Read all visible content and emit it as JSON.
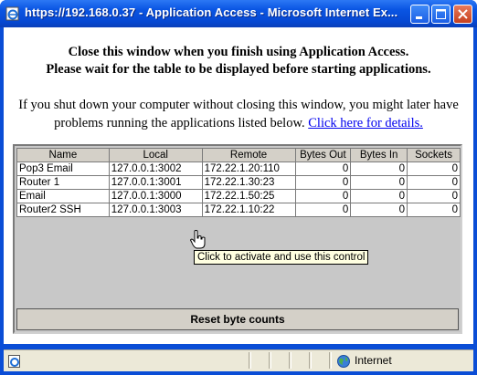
{
  "window": {
    "title": "https://192.168.0.37 - Application Access - Microsoft Internet Ex...",
    "buttons": [
      "minimize-icon",
      "maximize-icon",
      "close-icon"
    ]
  },
  "content": {
    "heading_line1": "Close this window when you finish using Application Access.",
    "heading_line2": "Please wait for the table to be displayed before starting applications.",
    "para_text": "If you shut down your computer without closing this window, you might later have problems running the applications listed below.",
    "details_link": "Click here for details."
  },
  "table": {
    "columns": [
      "Name",
      "Local",
      "Remote",
      "Bytes Out",
      "Bytes In",
      "Sockets"
    ],
    "rows": [
      [
        "Pop3 Email",
        "127.0.0.1:3002",
        "172.22.1.20:110",
        "0",
        "0",
        "0"
      ],
      [
        "Router 1",
        "127.0.0.1:3001",
        "172.22.1.30:23",
        "0",
        "0",
        "0"
      ],
      [
        "Email",
        "127.0.0.1:3000",
        "172.22.1.50:25",
        "0",
        "0",
        "0"
      ],
      [
        "Router2 SSH",
        "127.0.0.1:3003",
        "172.22.1.10:22",
        "0",
        "0",
        "0"
      ]
    ],
    "reset_label": "Reset byte counts"
  },
  "tooltip": "Click to activate and use this control",
  "statusbar": {
    "zone": "Internet"
  },
  "colors": {
    "titlebar": "#0a55e3",
    "link": "#0000ee",
    "tooltip_bg": "#ffffe1"
  }
}
